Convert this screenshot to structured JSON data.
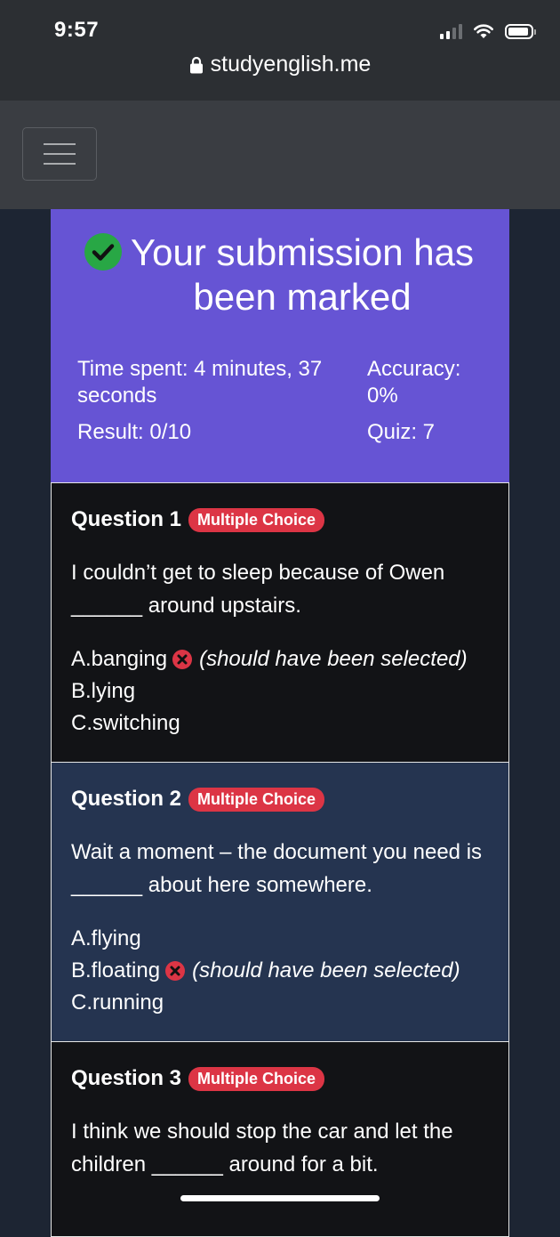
{
  "status_bar": {
    "time": "9:57"
  },
  "browser": {
    "url": "studyenglish.me"
  },
  "result": {
    "title": "Your submission has been marked",
    "time_spent_line1": "Time spent: 4 minutes, 37",
    "time_spent_line2": "seconds",
    "accuracy_line1": "Accuracy:",
    "accuracy_line2": "0%",
    "result": "Result: 0/10",
    "quiz": "Quiz: 7"
  },
  "questions": [
    {
      "title": "Question 1",
      "type": "Multiple Choice",
      "text_line1": "I couldn’t get to sleep because of Owen",
      "text_line2": "______ around upstairs.",
      "options": [
        "A.banging",
        "B.lying",
        "C.switching"
      ],
      "note": "(should have been selected)"
    },
    {
      "title": "Question 2",
      "type": "Multiple Choice",
      "text_line1": "Wait a moment – the document you need is",
      "text_line2": "______ about here somewhere.",
      "options": [
        "A.flying",
        "B.floating",
        "C.running"
      ],
      "note": "(should have been selected)"
    },
    {
      "title": "Question 3",
      "type": "Multiple Choice",
      "text_line1": "I think we should stop the car and let the",
      "text_line2": "children ______ around for a bit."
    }
  ],
  "colors": {
    "header_bg": "#6654d4",
    "badge_bg": "#dc3545",
    "correct_green": "#28a745",
    "wrong_red": "#dc3545"
  },
  "icons": [
    "lock-icon",
    "check-circle-icon",
    "x-circle-icon",
    "hamburger-menu-icon",
    "signal-icon",
    "wifi-icon",
    "battery-icon"
  ]
}
